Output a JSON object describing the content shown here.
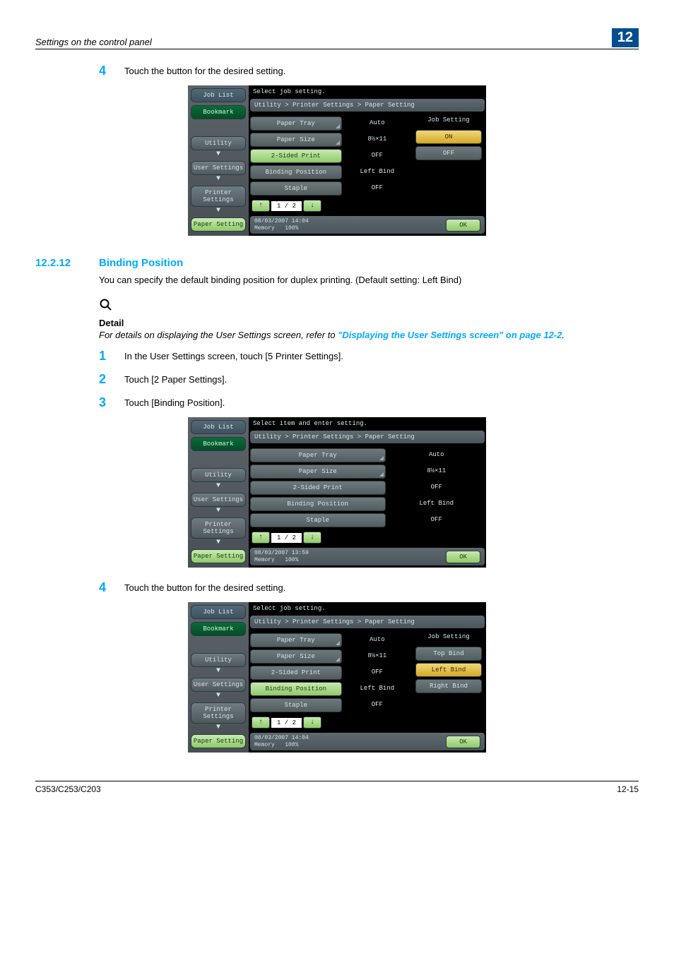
{
  "header": {
    "left": "Settings on the control panel",
    "right": "12"
  },
  "steps_a": [
    {
      "num": "4",
      "text": "Touch the button for the desired setting."
    }
  ],
  "section": {
    "num": "12.2.12",
    "title": "Binding Position",
    "intro": "You can specify the default binding position for duplex printing. (Default setting: Left Bind)"
  },
  "detail": {
    "label": "Detail",
    "text_before": "For details on displaying the User Settings screen, refer to ",
    "link": "\"Displaying the User Settings screen\" on page 12-2",
    "text_after": "."
  },
  "steps_b": [
    {
      "num": "1",
      "text": "In the User Settings screen, touch [5 Printer Settings]."
    },
    {
      "num": "2",
      "text": "Touch [2 Paper Settings]."
    },
    {
      "num": "3",
      "text": "Touch [Binding Position]."
    }
  ],
  "steps_c": [
    {
      "num": "4",
      "text": "Touch the button for the desired setting."
    }
  ],
  "screen_common": {
    "job_list": "Job List",
    "bookmark": "Bookmark",
    "crumbs": [
      "Utility",
      "User Settings",
      "Printer Settings",
      "Paper Setting"
    ],
    "breadcrumb_line": "Utility > Printer Settings > Paper Setting",
    "rows": [
      {
        "label": "Paper Tray",
        "value": "Auto",
        "corner": true
      },
      {
        "label": "Paper Size",
        "value": "8½×11",
        "corner": true
      },
      {
        "label": "2-Sided Print",
        "value": "OFF"
      },
      {
        "label": "Binding Position",
        "value": "Left Bind"
      },
      {
        "label": "Staple",
        "value": "OFF"
      }
    ],
    "pager": "1 / 2",
    "memory": "Memory",
    "mem_pct": "100%",
    "ok": "OK"
  },
  "screen1": {
    "instruction": "Select job setting.",
    "datetime": "08/03/2007   14:04",
    "selected_row": 2,
    "right_head": "Job Setting",
    "right_opts": [
      {
        "label": "ON",
        "sel": true
      },
      {
        "label": "OFF",
        "sel": false
      }
    ]
  },
  "screen2": {
    "instruction": "Select item and enter setting.",
    "datetime": "08/03/2007   13:59",
    "selected_row": -1,
    "right_head": "",
    "right_opts": []
  },
  "screen3": {
    "instruction": "Select job setting.",
    "datetime": "08/03/2007   14:04",
    "selected_row": 3,
    "right_head": "Job Setting",
    "right_opts": [
      {
        "label": "Top Bind",
        "sel": false
      },
      {
        "label": "Left Bind",
        "sel": true
      },
      {
        "label": "Right Bind",
        "sel": false
      }
    ]
  },
  "footer": {
    "left": "C353/C253/C203",
    "right": "12-15"
  }
}
